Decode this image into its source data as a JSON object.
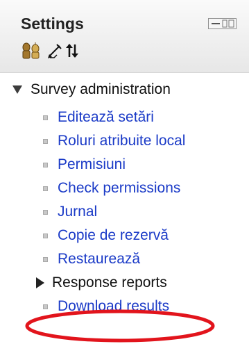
{
  "block": {
    "title": "Settings",
    "header_icons": [
      "users-icon",
      "pencil-icon",
      "move-icon"
    ]
  },
  "section": {
    "label": "Survey administration",
    "items": [
      {
        "label": "Editează setări",
        "type": "link"
      },
      {
        "label": "Roluri atribuite local",
        "type": "link"
      },
      {
        "label": "Permisiuni",
        "type": "link"
      },
      {
        "label": "Check permissions",
        "type": "link"
      },
      {
        "label": "Jurnal",
        "type": "link"
      },
      {
        "label": "Copie de rezervă",
        "type": "link"
      },
      {
        "label": "Restaurează",
        "type": "link"
      },
      {
        "label": "Response reports",
        "type": "collapsed-node"
      },
      {
        "label": "Download results",
        "type": "link",
        "highlighted": true
      }
    ]
  },
  "colors": {
    "link": "#1a3ac7",
    "highlight": "#e2141c",
    "header_bg": "#eeeeee"
  }
}
